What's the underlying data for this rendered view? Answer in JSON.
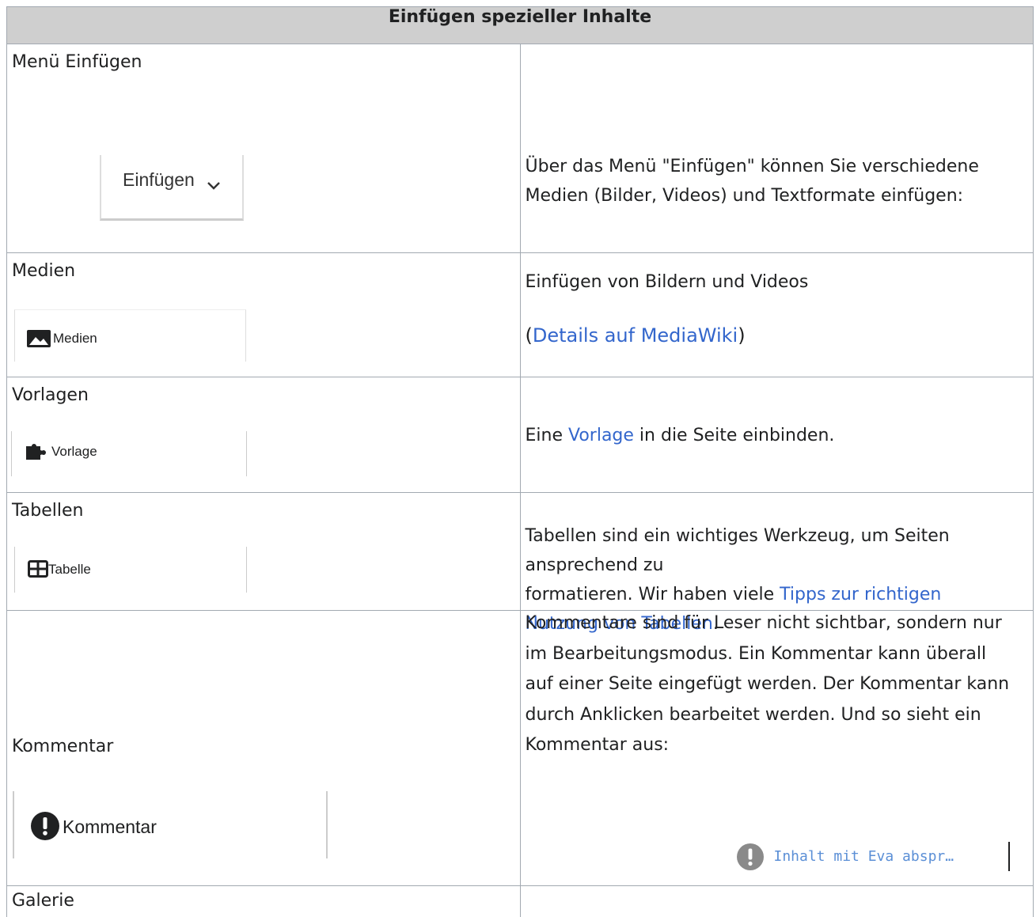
{
  "table": {
    "title": "Einfügen spezieller Inhalte",
    "rows": {
      "menu": {
        "label": "Menü Einfügen",
        "button_label": "Einfügen",
        "description": "Über das Menü \"Einfügen\" können Sie verschiedene Medien (Bilder, Videos) und Textformate einfügen:"
      },
      "medien": {
        "label": "Medien",
        "button_label": "Medien",
        "description": "Einfügen von Bildern und Videos",
        "paren_open": "(",
        "link": "Details auf MediaWiki",
        "paren_close": ")"
      },
      "vorlagen": {
        "label": "Vorlagen",
        "button_label": "Vorlage",
        "text_before": "Eine ",
        "link": "Vorlage",
        "text_after": " in die Seite einbinden."
      },
      "tabellen": {
        "label": "Tabellen",
        "button_label": "Tabelle",
        "text_line1": "Tabellen sind ein wichtiges Werkzeug, um Seiten ansprechend zu",
        "text_line2_before": "formatieren. Wir haben viele ",
        "link": "Tipps zur richtigen Nutzung von Tabellen",
        "text_after": "."
      },
      "kommentar": {
        "label": "Kommentar",
        "button_label": "Kommentar",
        "description": "Kommentare sind für Leser nicht sichtbar, sondern nur im Bearbeitungsmodus. Ein Kommentar kann überall auf einer Seite eingefügt werden. Der Kommentar kann durch Anklicken bearbeitet werden. Und so sieht ein Kommentar aus:",
        "example_text": "Inhalt mit Eva abspr…"
      },
      "galerie": {
        "label": "Galerie"
      }
    }
  },
  "colors": {
    "link": "#3366cc",
    "header_bg": "#cfcfcf",
    "border": "#a2a9b1",
    "comment_icon": "#8a8a8a"
  },
  "icons": [
    "chevron-down-icon",
    "image-icon",
    "puzzle-icon",
    "table-icon",
    "exclamation-icon"
  ]
}
